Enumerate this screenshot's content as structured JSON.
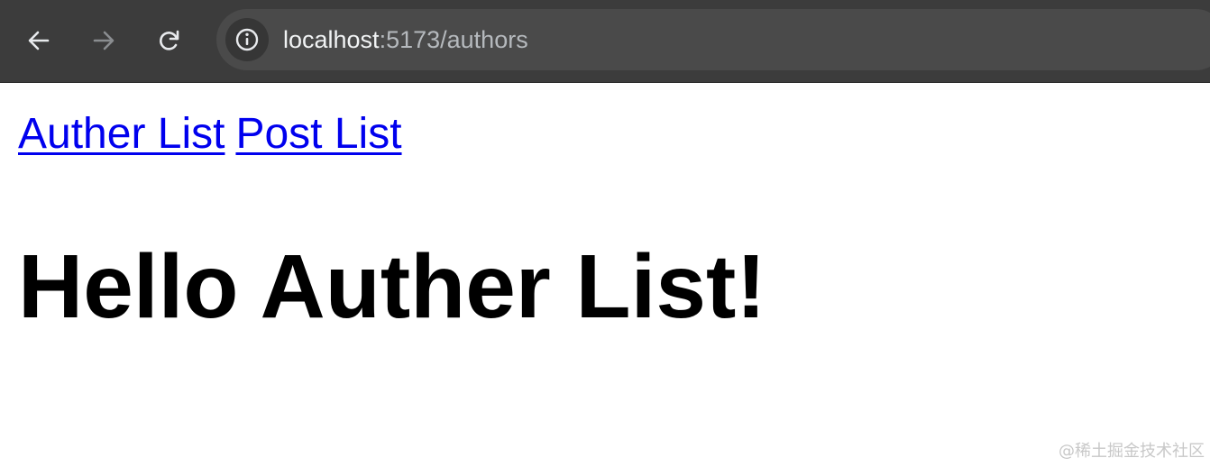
{
  "browser": {
    "url_host": "localhost",
    "url_path": ":5173/authors",
    "icons": {
      "back": "arrow-left-icon",
      "forward": "arrow-right-icon",
      "reload": "reload-icon",
      "site_info": "info-icon"
    },
    "colors": {
      "toolbar": "#3c3c3c",
      "omnibox": "#4a4a4a"
    }
  },
  "nav": {
    "links": [
      {
        "label": "Auther List"
      },
      {
        "label": "Post List"
      }
    ],
    "link_color": "#0000ee"
  },
  "main": {
    "heading": "Hello Auther List!"
  },
  "watermark": "@稀土掘金技术社区"
}
